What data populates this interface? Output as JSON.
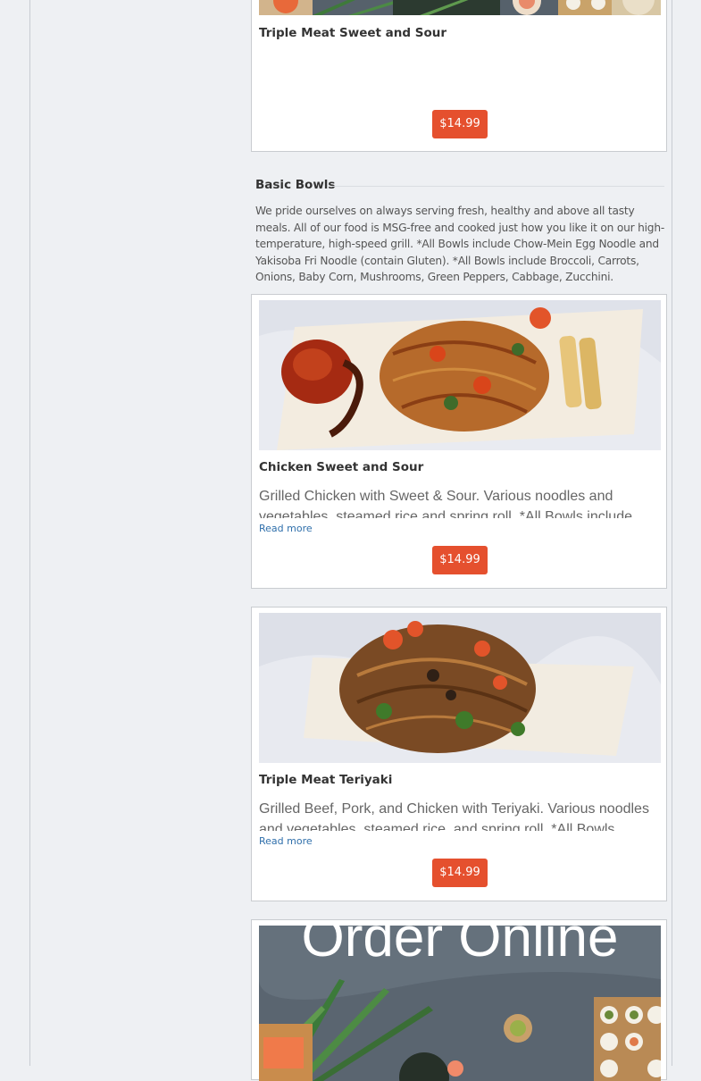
{
  "menu": {
    "items": [
      {
        "name": "Triple Meat Sweet and Sour",
        "price": "$14.99"
      }
    ],
    "section": {
      "title": "Basic Bowls",
      "description": "We pride ourselves on always serving fresh, healthy and above all tasty meals. All of our food is MSG-free and cooked just how you like it on our high-temperature, high-speed grill. *All Bowls include Chow-Mein Egg Noodle and Yakisoba Fri Noodle (contain Gluten). *All Bowls include Broccoli, Carrots, Onions, Baby Corn, Mushrooms, Green Peppers, Cabbage, Zucchini."
    },
    "bowls": [
      {
        "name": "Chicken Sweet and Sour",
        "description": "Grilled Chicken with Sweet & Sour. Various noodles and vegetables, steamed rice and spring roll. *All Bowls include",
        "read_more": "Read more",
        "price": "$14.99"
      },
      {
        "name": "Triple Meat Teriyaki",
        "description": "Grilled Beef, Pork, and Chicken with Teriyaki. Various noodles and vegetables, steamed rice, and spring roll. *All Bowls include",
        "read_more": "Read more",
        "price": "$14.99"
      }
    ],
    "promo_image_text": "Order Online"
  },
  "colors": {
    "price_button": "#e5502e",
    "read_more_link": "#2f6fab"
  }
}
